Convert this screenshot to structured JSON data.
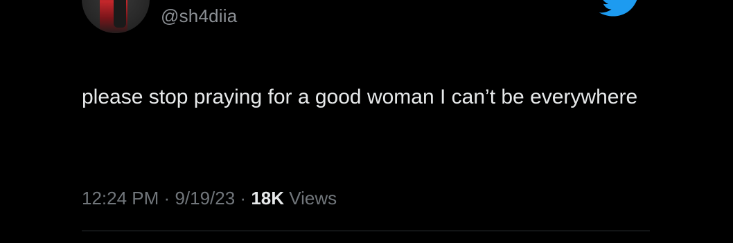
{
  "author": {
    "handle": "@sh4diia",
    "avatar_icon": "avatar-image",
    "platform_icon": "twitter-bird-icon"
  },
  "tweet": {
    "text": "please stop praying for a good woman I can’t be everywhere",
    "time": "12:24 PM",
    "separator": "·",
    "date": "9/19/23",
    "view_count": "18K",
    "view_label": "Views"
  },
  "colors": {
    "background": "#000000",
    "text_primary": "#e7e9ea",
    "text_secondary": "#71767b",
    "brand": "#1d9bf0",
    "divider": "#2f3336"
  }
}
